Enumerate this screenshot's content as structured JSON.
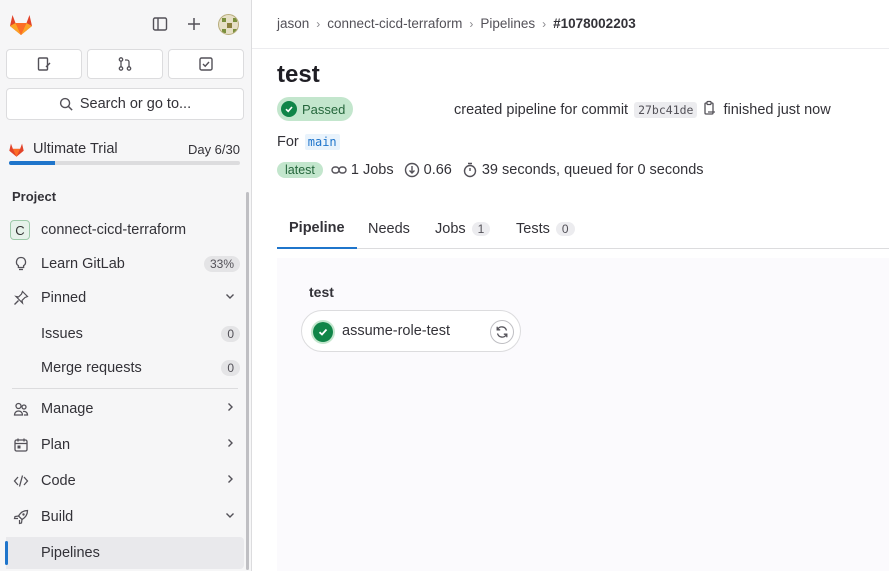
{
  "sidebar": {
    "search_label": "Search or go to...",
    "trial": {
      "label": "Ultimate Trial",
      "day": "Day 6/30",
      "progress": 0.2
    },
    "section_title": "Project",
    "project_name": "connect-cicd-terraform",
    "project_initial": "C",
    "learn": {
      "label": "Learn GitLab",
      "badge": "33%"
    },
    "pinned": {
      "label": "Pinned"
    },
    "issues": {
      "label": "Issues",
      "badge": "0"
    },
    "merge_requests": {
      "label": "Merge requests",
      "badge": "0"
    },
    "manage": {
      "label": "Manage"
    },
    "plan": {
      "label": "Plan"
    },
    "code": {
      "label": "Code"
    },
    "build": {
      "label": "Build"
    },
    "pipelines": {
      "label": "Pipelines"
    }
  },
  "breadcrumb": {
    "items": [
      "jason",
      "connect-cicd-terraform",
      "Pipelines"
    ],
    "current": "#1078002203"
  },
  "pipeline": {
    "title": "test",
    "status": "Passed",
    "created_text": "created pipeline for commit",
    "commit_sha": "27bc41de",
    "finished_text": "finished just now",
    "for_text": "For",
    "branch": "main",
    "latest_badge": "latest",
    "jobs": "1 Jobs",
    "coverage": "0.66",
    "duration": "39 seconds, queued for 0 seconds"
  },
  "tabs": {
    "pipeline": "Pipeline",
    "needs": "Needs",
    "jobs": "Jobs",
    "jobs_count": "1",
    "tests": "Tests",
    "tests_count": "0"
  },
  "graph": {
    "stage": "test",
    "job_name": "assume-role-test"
  },
  "colors": {
    "accent": "#1f75cb",
    "success": "#108548",
    "success_bg": "#c3e6cd"
  }
}
